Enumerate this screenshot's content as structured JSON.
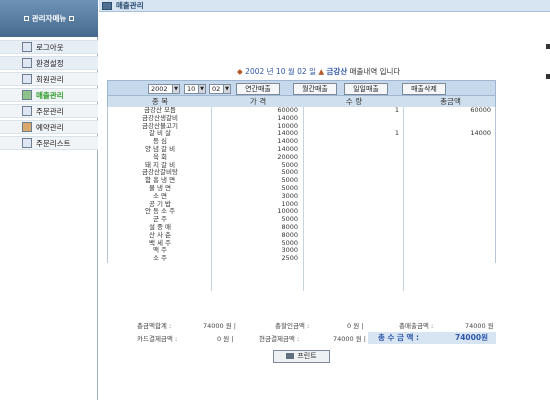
{
  "sidebar": {
    "title": "관리자메뉴",
    "items": [
      {
        "label": "로그아웃",
        "icon": "logout-icon",
        "active": false
      },
      {
        "label": "환경설정",
        "icon": "settings-icon",
        "active": false
      },
      {
        "label": "회원관리",
        "icon": "member-icon",
        "active": false
      },
      {
        "label": "매출관리",
        "icon": "sales-icon",
        "active": true
      },
      {
        "label": "주문관리",
        "icon": "order-icon",
        "active": false
      },
      {
        "label": "예약관리",
        "icon": "reservation-icon",
        "active": false
      },
      {
        "label": "주문리스트",
        "icon": "order-list-icon",
        "active": false
      }
    ]
  },
  "header": {
    "title": "매출관리"
  },
  "summary": {
    "date": "2002 년 10 월 02 일",
    "store": "금강산",
    "suffix": "매출내역 입니다"
  },
  "filters": {
    "year": "2002",
    "month": "10",
    "day": "02",
    "buttons": [
      "연간매출",
      "월간매출",
      "일일매출",
      "매출삭제"
    ]
  },
  "table": {
    "headers": [
      "종   목",
      "가   격",
      "수   량",
      "총금액"
    ],
    "rows": [
      [
        "금강산 모듬",
        "60000",
        "1",
        "60000"
      ],
      [
        "금강산생갈비",
        "14000",
        "",
        ""
      ],
      [
        "금강산불고기",
        "10000",
        "",
        ""
      ],
      [
        "갈   비   살",
        "14000",
        "1",
        "14000"
      ],
      [
        "등        심",
        "14000",
        "",
        ""
      ],
      [
        "양  념  갈  비",
        "14000",
        "",
        ""
      ],
      [
        "육        회",
        "20000",
        "",
        ""
      ],
      [
        "돼  지  갈  비",
        "5000",
        "",
        ""
      ],
      [
        "금강산갈비탕",
        "5000",
        "",
        ""
      ],
      [
        "함  흥  냉  면",
        "5000",
        "",
        ""
      ],
      [
        "물     냉     면",
        "5000",
        "",
        ""
      ],
      [
        "소        면",
        "3000",
        "",
        ""
      ],
      [
        "공    기    밥",
        "1000",
        "",
        ""
      ],
      [
        "안  동  소  주",
        "10000",
        "",
        ""
      ],
      [
        "군        주",
        "5000",
        "",
        ""
      ],
      [
        "설    중    매",
        "8000",
        "",
        ""
      ],
      [
        "산    사    춘",
        "8000",
        "",
        ""
      ],
      [
        "백    세    주",
        "5000",
        "",
        ""
      ],
      [
        "맥        주",
        "3000",
        "",
        ""
      ],
      [
        "소        주",
        "2500",
        "",
        ""
      ]
    ]
  },
  "totals": {
    "sales_total_label": "총금액합계 :",
    "sales_total_value": "74000 원 |",
    "discount_label": "총할인금액 :",
    "discount_value": "0 원 |",
    "gross_label": "총매출금액 :",
    "gross_value": "74000 원",
    "card_label": "카드결제금액 :",
    "card_value": "0 원 |",
    "cash_label": "현금결제금액 :",
    "cash_value": "74000 원 |",
    "grand_label": "총 수 금 액 :",
    "grand_value": "74000원"
  },
  "print_label": "프린트"
}
